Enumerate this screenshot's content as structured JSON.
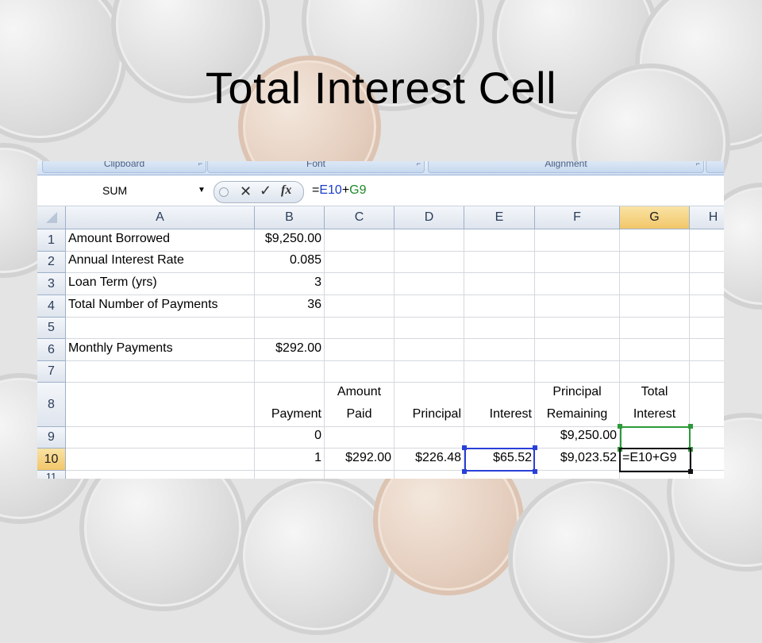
{
  "slide": {
    "title": "Total Interest Cell"
  },
  "ribbon": {
    "groups": [
      "Clipboard",
      "Font",
      "Alignment"
    ]
  },
  "formula_bar": {
    "name_box": "SUM",
    "formula_prefix": "=",
    "ref1": "E10",
    "operator": "+",
    "ref2": "G9",
    "fx_label": "fx"
  },
  "sheet": {
    "columns": [
      "A",
      "B",
      "C",
      "D",
      "E",
      "F",
      "G",
      "H"
    ],
    "selected_column": "G",
    "selected_row": "10",
    "rows": [
      "1",
      "2",
      "3",
      "4",
      "5",
      "6",
      "7",
      "8",
      "9",
      "10",
      "11"
    ],
    "cells": {
      "A1": "Amount Borrowed",
      "B1": "$9,250.00",
      "A2": "Annual Interest Rate",
      "B2": "0.085",
      "A3": "Loan Term (yrs)",
      "B3": "3",
      "A4": "Total Number of Payments",
      "B4": "36",
      "A6": "Monthly Payments",
      "B6": "$292.00",
      "B8": "Payment",
      "C8_line1": "Amount",
      "C8_line2": "Paid",
      "D8": "Principal",
      "E8": "Interest",
      "F8_line1": "Principal",
      "F8_line2": "Remaining",
      "G8_line1": "Total",
      "G8_line2": "Interest",
      "B9": "0",
      "F9": "$9,250.00",
      "B10": "1",
      "C10": "$292.00",
      "D10": "$226.48",
      "E10": "$65.52",
      "F10": "$9,023.52",
      "G10": "=E10+G9"
    }
  },
  "colors": {
    "ref1_color": "#1b3ec7",
    "ref2_color": "#1e8a2a",
    "header_selected": "#f2c66a"
  }
}
